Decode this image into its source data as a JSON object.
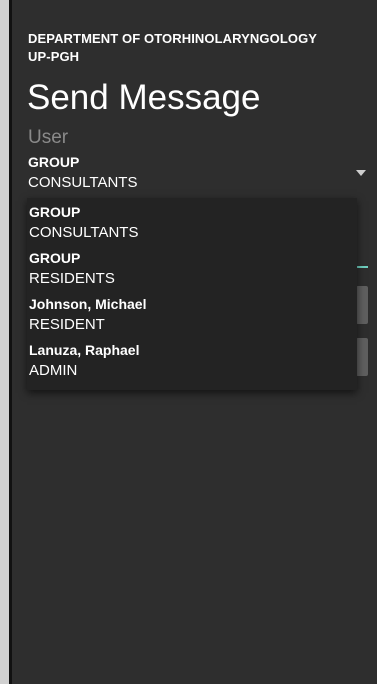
{
  "header": {
    "department": "DEPARTMENT OF OTORHINOLARYNGOLOGY",
    "institution": "UP-PGH",
    "title": "Send Message"
  },
  "recipient_field": {
    "label": "User",
    "selected": {
      "title": "GROUP",
      "subtitle": "CONSULTANTS"
    }
  },
  "dropdown": {
    "items": [
      {
        "title": "GROUP",
        "subtitle": "CONSULTANTS"
      },
      {
        "title": "GROUP",
        "subtitle": "RESIDENTS"
      },
      {
        "title": "Johnson, Michael",
        "subtitle": "RESIDENT"
      },
      {
        "title": "Lanuza, Raphael",
        "subtitle": "ADMIN"
      }
    ]
  },
  "colors": {
    "background": "#2e2e2e",
    "menu_background": "#232323",
    "accent": "#6fcfbf",
    "label_gray": "#8a8a8a"
  },
  "icons": {
    "dropdown_arrow": "triangle-down-icon"
  }
}
